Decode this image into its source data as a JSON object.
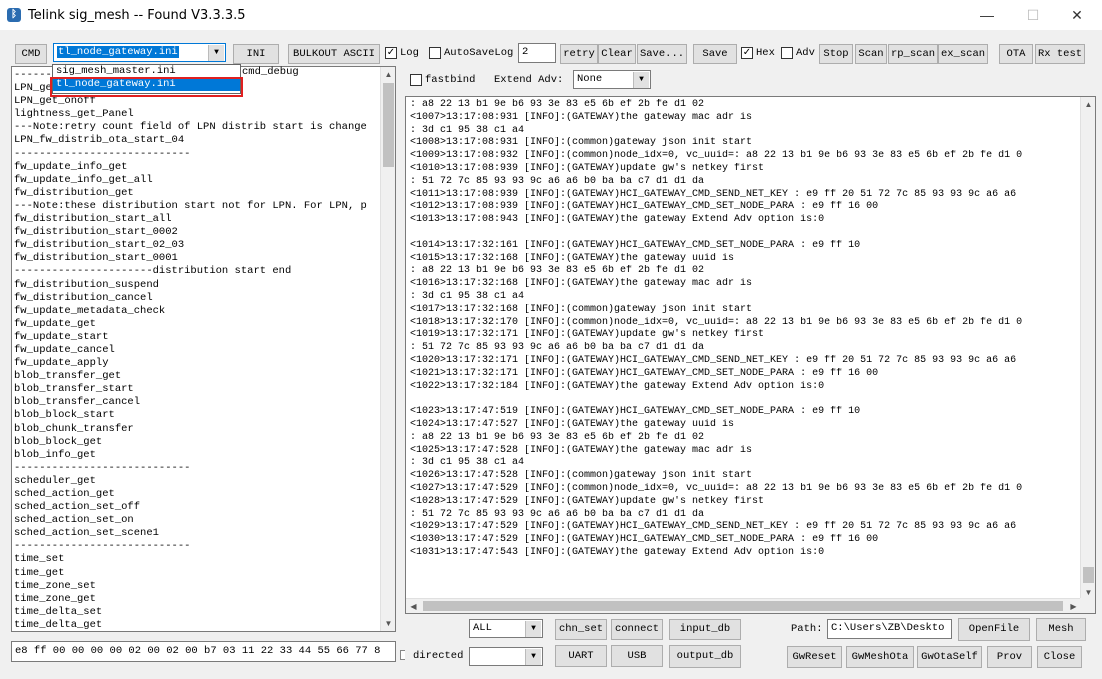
{
  "window": {
    "title": "Telink sig_mesh -- Found  V3.3.3.5",
    "icon_name": "bluetooth-icon",
    "minimize": "—",
    "maximize": "☐",
    "close": "✕"
  },
  "toolbar": {
    "cmd": "CMD",
    "ini_combo_value": "tl_node_gateway.ini",
    "ini": "INI",
    "bulkout": "BULKOUT ASCII",
    "log_label": "Log",
    "log_checked": true,
    "autosave_label": "AutoSaveLog",
    "autosave_checked": false,
    "autosave_count": "2",
    "retry": "retry",
    "clear": "Clear",
    "save_as": "Save...",
    "save": "Save",
    "hex_label": "Hex",
    "hex_checked": true,
    "adv_label": "Adv",
    "adv_checked": false,
    "stop": "Stop",
    "scan": "Scan",
    "rp_scan": "rp_scan",
    "ex_scan": "ex_scan",
    "ota": "OTA",
    "rx_test": "Rx test"
  },
  "options_row": {
    "fastbind_label": "fastbind",
    "fastbind_checked": false,
    "extend_adv_label": "Extend Adv:",
    "extend_adv_value": "None"
  },
  "ini_dropdown": {
    "options": [
      "sig_mesh_master.ini",
      "tl_node_gateway.ini"
    ],
    "selected": "tl_node_gateway.ini",
    "partial_behind": "cmd_debug"
  },
  "command_list": [
    "------",
    "LPN_ge",
    "LPN_get_onoff",
    "lightness_get_Panel",
    "---Note:retry count field of LPN distrib start is change",
    "LPN_fw_distrib_ota_start_04",
    "----------------------------",
    "fw_update_info_get",
    "fw_update_info_get_all",
    "fw_distribution_get",
    "---Note:these distribution start not for LPN. For LPN, p",
    "fw_distribution_start_all",
    "fw_distribution_start_0002",
    "fw_distribution_start_02_03",
    "fw_distribution_start_0001",
    "----------------------distribution start end",
    "fw_distribution_suspend",
    "fw_distribution_cancel",
    "fw_update_metadata_check",
    "fw_update_get",
    "fw_update_start",
    "fw_update_cancel",
    "fw_update_apply",
    "blob_transfer_get",
    "blob_transfer_start",
    "blob_transfer_cancel",
    "blob_block_start",
    "blob_chunk_transfer",
    "blob_block_get",
    "blob_info_get",
    "----------------------------",
    "scheduler_get",
    "sched_action_get",
    "sched_action_set_off",
    "sched_action_set_on",
    "sched_action_set_scene1",
    "----------------------------",
    "time_set",
    "time_get",
    "time_zone_set",
    "time_zone_get",
    "time_delta_set",
    "time_delta_get"
  ],
  "command_input": "e8 ff 00 00 00 00 02 00 02 00 b7 03 11 22 33 44 55 66 77 8",
  "log_lines": [
    ": a8 22 13 b1 9e b6 93 3e 83 e5 6b ef 2b fe d1 02",
    "<1007>13:17:08:931 [INFO]:(GATEWAY)the gateway mac adr is",
    ": 3d c1 95 38 c1 a4",
    "<1008>13:17:08:931 [INFO]:(common)gateway json init start",
    "<1009>13:17:08:932 [INFO]:(common)node_idx=0, vc_uuid=: a8 22 13 b1 9e b6 93 3e 83 e5 6b ef 2b fe d1 0",
    "<1010>13:17:08:939 [INFO]:(GATEWAY)update gw's netkey first",
    ": 51 72 7c 85 93 93 9c a6 a6 b0 ba ba c7 d1 d1 da",
    "<1011>13:17:08:939 [INFO]:(GATEWAY)HCI_GATEWAY_CMD_SEND_NET_KEY : e9 ff 20 51 72 7c 85 93 93 9c a6 a6",
    "<1012>13:17:08:939 [INFO]:(GATEWAY)HCI_GATEWAY_CMD_SET_NODE_PARA : e9 ff 16 00",
    "<1013>13:17:08:943 [INFO]:(GATEWAY)the gateway Extend Adv option is:0",
    "",
    "<1014>13:17:32:161 [INFO]:(GATEWAY)HCI_GATEWAY_CMD_SET_NODE_PARA : e9 ff 10",
    "<1015>13:17:32:168 [INFO]:(GATEWAY)the gateway uuid is",
    ": a8 22 13 b1 9e b6 93 3e 83 e5 6b ef 2b fe d1 02",
    "<1016>13:17:32:168 [INFO]:(GATEWAY)the gateway mac adr is",
    ": 3d c1 95 38 c1 a4",
    "<1017>13:17:32:168 [INFO]:(common)gateway json init start",
    "<1018>13:17:32:170 [INFO]:(common)node_idx=0, vc_uuid=: a8 22 13 b1 9e b6 93 3e 83 e5 6b ef 2b fe d1 0",
    "<1019>13:17:32:171 [INFO]:(GATEWAY)update gw's netkey first",
    ": 51 72 7c 85 93 93 9c a6 a6 b0 ba ba c7 d1 d1 da",
    "<1020>13:17:32:171 [INFO]:(GATEWAY)HCI_GATEWAY_CMD_SEND_NET_KEY : e9 ff 20 51 72 7c 85 93 93 9c a6 a6",
    "<1021>13:17:32:171 [INFO]:(GATEWAY)HCI_GATEWAY_CMD_SET_NODE_PARA : e9 ff 16 00",
    "<1022>13:17:32:184 [INFO]:(GATEWAY)the gateway Extend Adv option is:0",
    "",
    "<1023>13:17:47:519 [INFO]:(GATEWAY)HCI_GATEWAY_CMD_SET_NODE_PARA : e9 ff 10",
    "<1024>13:17:47:527 [INFO]:(GATEWAY)the gateway uuid is",
    ": a8 22 13 b1 9e b6 93 3e 83 e5 6b ef 2b fe d1 02",
    "<1025>13:17:47:528 [INFO]:(GATEWAY)the gateway mac adr is",
    ": 3d c1 95 38 c1 a4",
    "<1026>13:17:47:528 [INFO]:(common)gateway json init start",
    "<1027>13:17:47:529 [INFO]:(common)node_idx=0, vc_uuid=: a8 22 13 b1 9e b6 93 3e 83 e5 6b ef 2b fe d1 0",
    "<1028>13:17:47:529 [INFO]:(GATEWAY)update gw's netkey first",
    ": 51 72 7c 85 93 93 9c a6 a6 b0 ba ba c7 d1 d1 da",
    "<1029>13:17:47:529 [INFO]:(GATEWAY)HCI_GATEWAY_CMD_SEND_NET_KEY : e9 ff 20 51 72 7c 85 93 93 9c a6 a6",
    "<1030>13:17:47:529 [INFO]:(GATEWAY)HCI_GATEWAY_CMD_SET_NODE_PARA : e9 ff 16 00",
    "<1031>13:17:47:543 [INFO]:(GATEWAY)the gateway Extend Adv option is:0"
  ],
  "bottom": {
    "filter_value": "ALL",
    "chn_set": "chn_set",
    "connect": "connect",
    "input_db": "input_db",
    "path_label": "Path:",
    "path_value": "C:\\Users\\ZB\\Deskto",
    "openfile": "OpenFile",
    "mesh": "Mesh",
    "directed_label": "directed",
    "directed_value": "",
    "uart": "UART",
    "usb": "USB",
    "output_db": "output_db",
    "gwreset": "GwReset",
    "gwmeshota": "GwMeshOta",
    "gwotaself": "GwOtaSelf",
    "prov": "Prov",
    "close": "Close"
  },
  "colors": {
    "selection": "#0078d7",
    "highlight_box": "#e02020"
  }
}
